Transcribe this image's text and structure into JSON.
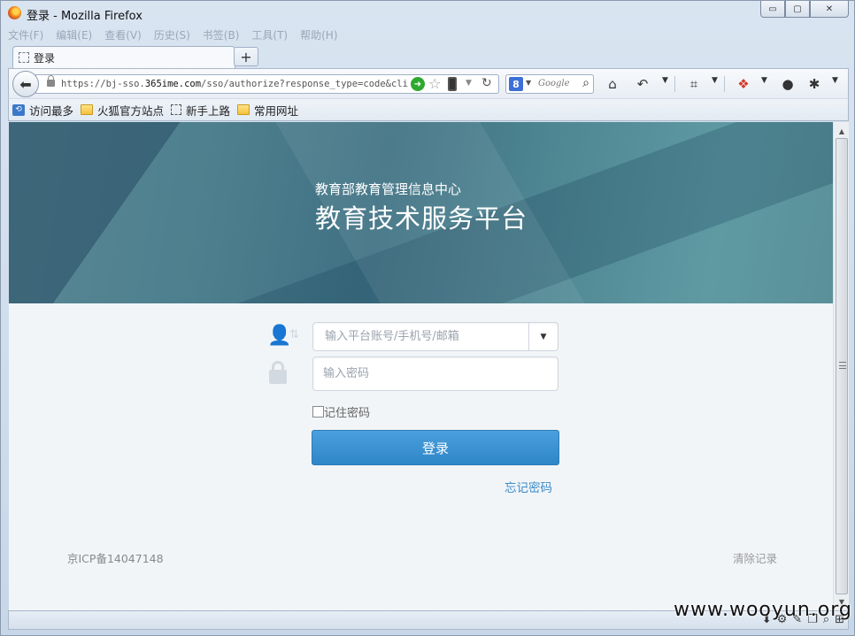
{
  "window": {
    "title": "登录 - Mozilla Firefox",
    "controls": {
      "minimize": "▭",
      "maximize": "▢",
      "close": "✕"
    }
  },
  "menu": [
    "文件(F)",
    "编辑(E)",
    "查看(V)",
    "历史(S)",
    "书签(B)",
    "工具(T)",
    "帮助(H)"
  ],
  "tabs": [
    {
      "label": "登录"
    }
  ],
  "new_tab_label": "+",
  "url": {
    "prefix": "https://bj-sso.",
    "domain": "365ime.com",
    "path": "/sso/authorize?response_type=code&client"
  },
  "search": {
    "engine_letter": "8",
    "placeholder": "Google"
  },
  "bookmarks": [
    {
      "label": "访问最多",
      "icon": "most-visited-icon"
    },
    {
      "label": "火狐官方站点",
      "icon": "folder-icon"
    },
    {
      "label": "新手上路",
      "icon": "page-icon"
    },
    {
      "label": "常用网址",
      "icon": "folder-icon"
    }
  ],
  "banner": {
    "subtitle": "教育部教育管理信息中心",
    "title": "教育技术服务平台"
  },
  "login": {
    "account_placeholder": "输入平台账号/手机号/邮箱",
    "password_placeholder": "输入密码",
    "remember_label": "记住密码",
    "submit_label": "登录",
    "forgot_label": "忘记密码"
  },
  "footer": {
    "icp": "京ICP备14047148",
    "clear_records": "清除记录"
  },
  "watermark": "www.wooyun.org"
}
